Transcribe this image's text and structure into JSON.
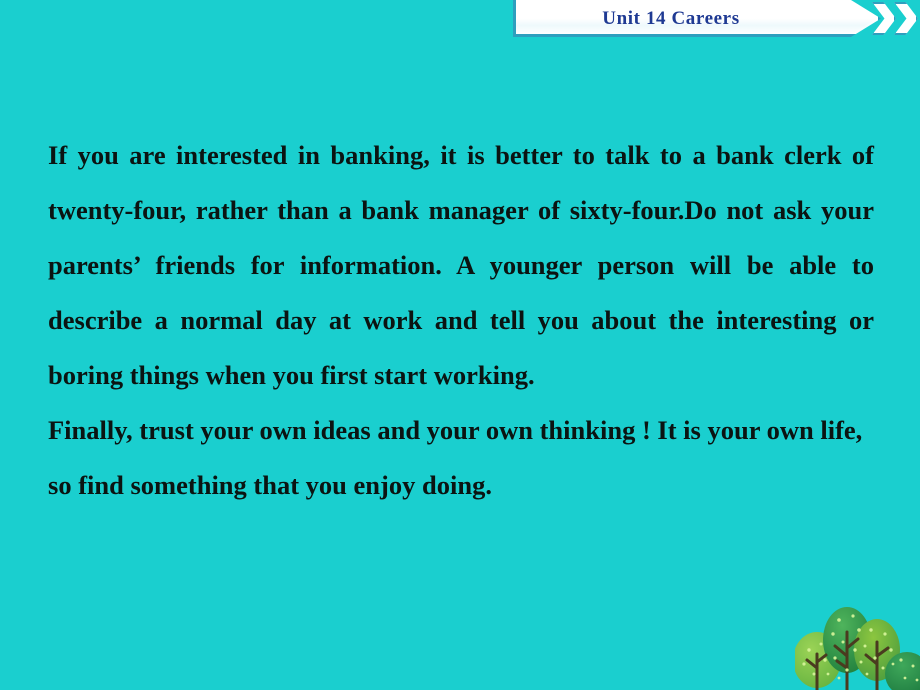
{
  "slide": {
    "background_color": "#1ACFCF",
    "text_color": "#0B1412"
  },
  "header": {
    "title": "Unit  14  Careers",
    "title_color": "#1F3A93",
    "plate_color": "#FFFFFF",
    "border_color": "#2E9FBE",
    "chevron_icon_name": "double-chevron-right-icon"
  },
  "content": {
    "paragraphs": [
      "If you are interested in banking,  it is better to talk to a bank clerk of twenty-four,  rather than a bank manager of sixty-four.Do not ask your parents’ friends for information. A younger person will be able to describe a normal day at work and tell you about the interesting or boring things when you first start working.",
      "Finally,  trust your own ideas and your own thinking ! It is your own life,  so find something that you enjoy doing."
    ]
  },
  "decoration": {
    "name": "trees-illustration",
    "canopy_colors": [
      "#7AC143",
      "#3DA34D",
      "#2E9E52",
      "#8CC63F"
    ],
    "trunk_color": "#4A3B1F",
    "speckle_color": "#C9F28E"
  }
}
